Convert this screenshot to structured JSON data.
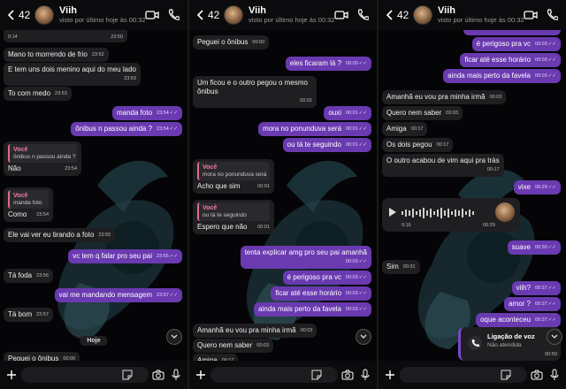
{
  "panels": [
    {
      "header": {
        "unread_count": "42",
        "contact_name": "Viih",
        "status": "visto por último hoje às 00:32"
      },
      "messages": [
        {
          "kind": "voice_partial",
          "time": "23:50",
          "duration": "0:14"
        },
        {
          "kind": "in",
          "text": "Mano to morrendo de frio",
          "time": "23:52"
        },
        {
          "kind": "in",
          "text": "E tem uns dois menino aqui do meu lado",
          "time": "23:53"
        },
        {
          "kind": "in",
          "text": "To com medo",
          "time": "23:53"
        },
        {
          "kind": "out",
          "text": "manda foto",
          "time": "23:54"
        },
        {
          "kind": "out",
          "text": "ônibus n passou ainda ?",
          "time": "23:54"
        },
        {
          "kind": "in",
          "quote_name": "Você",
          "quote_text": "ônibus n passou ainda ?",
          "text": "Não",
          "time": "23:54"
        },
        {
          "kind": "in",
          "quote_name": "Você",
          "quote_text": "manda foto",
          "text": "Como",
          "time": "23:54"
        },
        {
          "kind": "in",
          "text": "Ele vai ver eu tirando a foto",
          "time": "23:55"
        },
        {
          "kind": "out",
          "text": "vc tem q falar pro seu pai",
          "time": "23:55"
        },
        {
          "kind": "in",
          "text": "Tá foda",
          "time": "23:56"
        },
        {
          "kind": "out",
          "text": "vai me mandando mensagem",
          "time": "23:57"
        },
        {
          "kind": "in",
          "text": "Tá bom",
          "time": "23:57"
        },
        {
          "kind": "day",
          "text": "Hoje"
        },
        {
          "kind": "in",
          "text": "Peguei o ônibus",
          "time": "00:00"
        }
      ]
    },
    {
      "header": {
        "unread_count": "42",
        "contact_name": "Viih",
        "status": "visto por último hoje às 00:32"
      },
      "messages": [
        {
          "kind": "in",
          "text": "Peguei o ônibus",
          "time": "00:00"
        },
        {
          "kind": "out",
          "text": "eles ficaram lá ?",
          "time": "00:00"
        },
        {
          "kind": "in",
          "text": "Um ficou e o outro pegou o mesmo ônibus",
          "time": "00:01"
        },
        {
          "kind": "out",
          "text": "ouxi",
          "time": "00:01"
        },
        {
          "kind": "out",
          "text": "mora no ponunduva será",
          "time": "00:01"
        },
        {
          "kind": "out",
          "text": "ou tá te seguindo",
          "time": "00:01"
        },
        {
          "kind": "in",
          "quote_name": "Você",
          "quote_text": "mora no ponunduva será",
          "text": "Acho que sim",
          "time": "00:01"
        },
        {
          "kind": "in",
          "quote_name": "Você",
          "quote_text": "ou tá te seguindo",
          "text": "Espero que não",
          "time": "00:01"
        },
        {
          "kind": "out",
          "text": "tenta explicar amg pro seu pai amanhã",
          "time": "00:03"
        },
        {
          "kind": "out",
          "text": "é perigoso pra vc",
          "time": "00:03"
        },
        {
          "kind": "out",
          "text": "ficar até esse horário",
          "time": "00:03"
        },
        {
          "kind": "out",
          "text": "ainda mais perto da favela",
          "time": "00:03"
        },
        {
          "kind": "in",
          "text": "Amanhã eu vou pra minha irmã",
          "time": "00:03"
        },
        {
          "kind": "in",
          "text": "Quero nem saber",
          "time": "00:03"
        },
        {
          "kind": "in",
          "text": "Amiga",
          "time": "00:17"
        }
      ]
    },
    {
      "header": {
        "unread_count": "42",
        "contact_name": "Viih",
        "status": "visto por último hoje às 00:32"
      },
      "messages": [
        {
          "kind": "out",
          "text": "é perigoso pra vc",
          "time": "00:03"
        },
        {
          "kind": "out",
          "text": "ficar até esse horário",
          "time": "00:03"
        },
        {
          "kind": "out",
          "text": "ainda mais perto da favela",
          "time": "00:03"
        },
        {
          "kind": "in",
          "text": "Amanhã eu vou pra minha irmã",
          "time": "00:03"
        },
        {
          "kind": "in",
          "text": "Quero nem saber",
          "time": "00:03"
        },
        {
          "kind": "in",
          "text": "Amiga",
          "time": "00:17"
        },
        {
          "kind": "in",
          "text": "Os dois pegou",
          "time": "00:17"
        },
        {
          "kind": "in",
          "text": "O outro acabou de vim aqui pra trás",
          "time": "00:17"
        },
        {
          "kind": "out",
          "text": "vixe",
          "time": "00:29"
        },
        {
          "kind": "voice",
          "elapsed": "0:16",
          "time": "00:29"
        },
        {
          "kind": "out",
          "text": "suave",
          "time": "00:30"
        },
        {
          "kind": "in",
          "text": "Sim",
          "time": "00:31"
        },
        {
          "kind": "out",
          "text": "viih?",
          "time": "00:37"
        },
        {
          "kind": "out",
          "text": "amor ?",
          "time": "00:37"
        },
        {
          "kind": "out",
          "text": "oque aconteceu",
          "time": "00:37"
        },
        {
          "kind": "call",
          "title": "Ligação de voz",
          "subtitle": "Não atendida",
          "time": "00:50"
        }
      ]
    }
  ],
  "colors": {
    "outgoing": "#6a3ab0",
    "incoming": "#1f1f22",
    "quote_name": "#f07aa0"
  },
  "icons": [
    "back-chevron-icon",
    "video-call-icon",
    "phone-icon",
    "plus-icon",
    "sticker-icon",
    "camera-icon",
    "microphone-icon",
    "scroll-down-icon",
    "play-icon",
    "missed-call-icon",
    "read-receipt-icon"
  ]
}
